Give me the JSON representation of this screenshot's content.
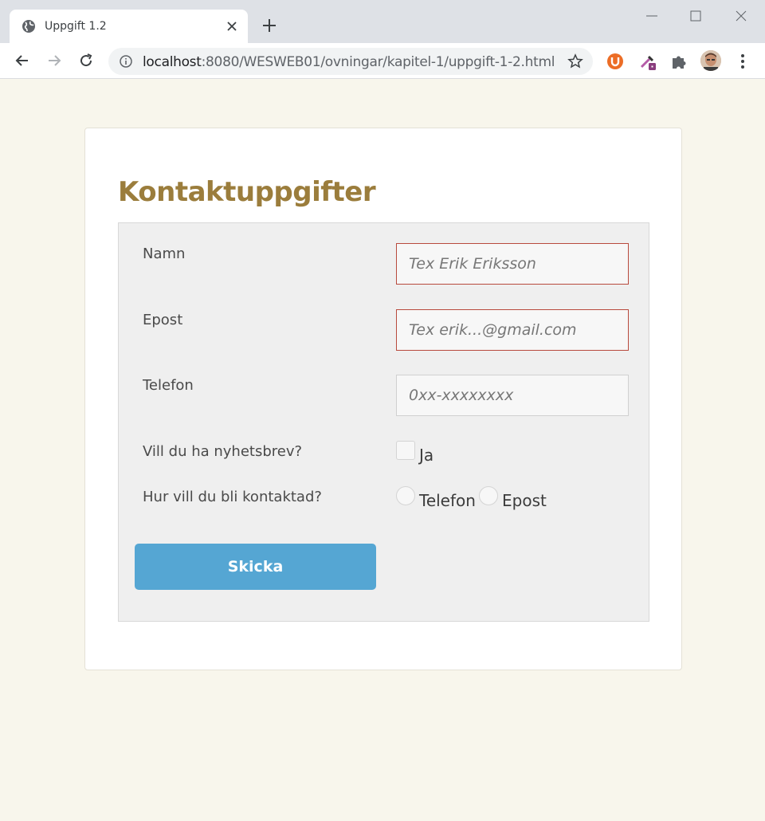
{
  "browser": {
    "tab": {
      "title": "Uppgift 1.2",
      "favicon": "globe-icon"
    },
    "url": {
      "host": "localhost",
      "path": ":8080/WESWEB01/ovningar/kapitel-1/uppgift-1-2.html"
    },
    "icons": [
      "back-icon",
      "forward-icon",
      "reload-icon",
      "info-icon",
      "star-icon",
      "ublock-icon",
      "eyedropper-icon",
      "puzzle-icon",
      "avatar",
      "menu-icon"
    ]
  },
  "page": {
    "title": "Kontaktuppgifter",
    "fields": {
      "name": {
        "label": "Namn",
        "placeholder": "Tex Erik Eriksson",
        "value": ""
      },
      "email": {
        "label": "Epost",
        "placeholder": "Tex erik...@gmail.com",
        "value": ""
      },
      "phone": {
        "label": "Telefon",
        "placeholder": "0xx-xxxxxxxx",
        "value": ""
      }
    },
    "newsletter": {
      "label": "Vill du ha nyhetsbrev?",
      "option": "Ja",
      "checked": false
    },
    "contact": {
      "label": "Hur vill du bli kontaktad?",
      "options": [
        "Telefon",
        "Epost"
      ],
      "selected": null
    },
    "submit_label": "Skicka"
  },
  "colors": {
    "page_bg": "#f8f6ec",
    "title": "#9b7d3c",
    "button": "#55a6d3",
    "invalid_border": "#b84a3d"
  }
}
